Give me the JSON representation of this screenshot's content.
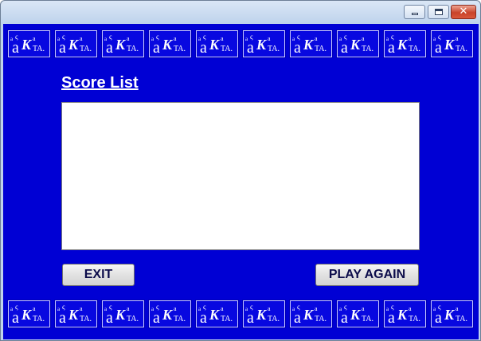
{
  "window": {
    "titlebar_buttons": {
      "minimize_icon": "minimize-icon",
      "maximize_icon": "maximize-icon",
      "close_icon": "close-icon",
      "close_glyph": "✕"
    }
  },
  "logo": {
    "icon": "aka-logo-icon",
    "small_a": "a",
    "hook": "ς",
    "big_a": "a",
    "k": "K",
    "superscript_a": "a",
    "ta": "TA.",
    "count_per_row": 10
  },
  "score": {
    "title": "Score List",
    "entries": []
  },
  "buttons": {
    "exit_label": "EXIT",
    "play_again_label": "PLAY AGAIN"
  },
  "colors": {
    "background": "#0000d4",
    "logo_tile": "#0808e0",
    "list_background": "#ffffff",
    "title_text": "#ffffff"
  }
}
